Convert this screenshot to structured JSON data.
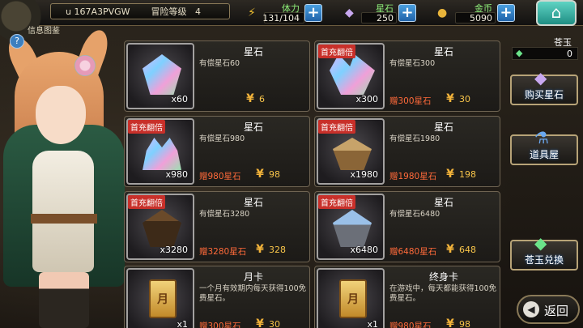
{
  "header": {
    "player_id": "u 167A3PVGW",
    "level_label": "冒险等级",
    "level": "4",
    "info_label": "信息图鉴",
    "help_icon": "?"
  },
  "resources": [
    {
      "label": "体力",
      "value": "131/104",
      "icon": "lightning-icon",
      "color": "#f0c030"
    },
    {
      "label": "星石",
      "value": "250",
      "icon": "gem-icon",
      "color": "#c8a8f0"
    },
    {
      "label": "金币",
      "value": "5090",
      "icon": "coin-icon",
      "color": "#e8b43a"
    }
  ],
  "jade": {
    "label": "苍玉",
    "value": "0"
  },
  "side_menu": [
    {
      "label": "购买星石",
      "icon": "gem-icon"
    },
    {
      "label": "道具屋",
      "icon": "potion-icon"
    },
    {
      "label": "苍玉兑换",
      "icon": "crystal-icon"
    }
  ],
  "back": {
    "label": "返回"
  },
  "currency_symbol": "¥",
  "badge_text": "首充翻倍",
  "cards": [
    {
      "title": "星石",
      "desc": "有偿星石60",
      "qty": "x60",
      "badge": false,
      "bonus": "",
      "price": "6",
      "art": "single"
    },
    {
      "title": "星石",
      "desc": "有偿星石300",
      "qty": "x300",
      "badge": true,
      "bonus": "赠300星石",
      "price": "30",
      "art": "pair"
    },
    {
      "title": "星石",
      "desc": "有偿星石980",
      "qty": "x980",
      "badge": true,
      "bonus": "赠980星石",
      "price": "98",
      "art": "pile"
    },
    {
      "title": "星石",
      "desc": "有偿星石1980",
      "qty": "x1980",
      "badge": true,
      "bonus": "赠1980星石",
      "price": "198",
      "art": "crate"
    },
    {
      "title": "星石",
      "desc": "有偿星石3280",
      "qty": "x3280",
      "badge": true,
      "bonus": "赠3280星石",
      "price": "328",
      "art": "chest"
    },
    {
      "title": "星石",
      "desc": "有偿星石6480",
      "qty": "x6480",
      "badge": true,
      "bonus": "赠6480星石",
      "price": "648",
      "art": "cart"
    },
    {
      "title": "月卡",
      "desc": "一个月有效期内每天获得100免费星石。",
      "qty": "x1",
      "badge": false,
      "bonus": "赠300星石",
      "price": "30",
      "art": "pass",
      "pass_char": "月"
    },
    {
      "title": "终身卡",
      "desc": "在游戏中，每天都能获得100免费星石。",
      "qty": "x1",
      "badge": false,
      "bonus": "赠980星石",
      "price": "98",
      "art": "pass",
      "pass_char": "月"
    }
  ]
}
